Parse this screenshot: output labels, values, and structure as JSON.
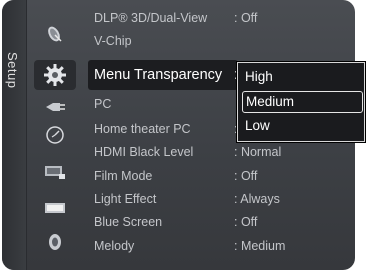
{
  "side_tab": {
    "label": "Setup"
  },
  "menu": {
    "items": [
      {
        "label": "DLP® 3D/Dual-View",
        "value": ": Off"
      },
      {
        "label": "V-Chip",
        "value": ""
      },
      {
        "label": "Menu Transparency",
        "value": ":"
      },
      {
        "label": "PC",
        "value": ""
      },
      {
        "label": "Home theater PC",
        "value": ":"
      },
      {
        "label": "HDMI Black Level",
        "value": ": Normal"
      },
      {
        "label": "Film Mode",
        "value": ": Off"
      },
      {
        "label": "Light Effect",
        "value": ": Always"
      },
      {
        "label": "Blue Screen",
        "value": ": Off"
      },
      {
        "label": "Melody",
        "value": ": Medium"
      }
    ],
    "selected_index": 2
  },
  "dropdown": {
    "options": [
      "High",
      "Medium",
      "Low"
    ],
    "highlighted": "Medium"
  },
  "icons": [
    "satellite-dish-icon",
    "gear-icon",
    "input-plug-icon",
    "clock-icon",
    "picture-icon",
    "sound-icon",
    "speaker-icon"
  ]
}
